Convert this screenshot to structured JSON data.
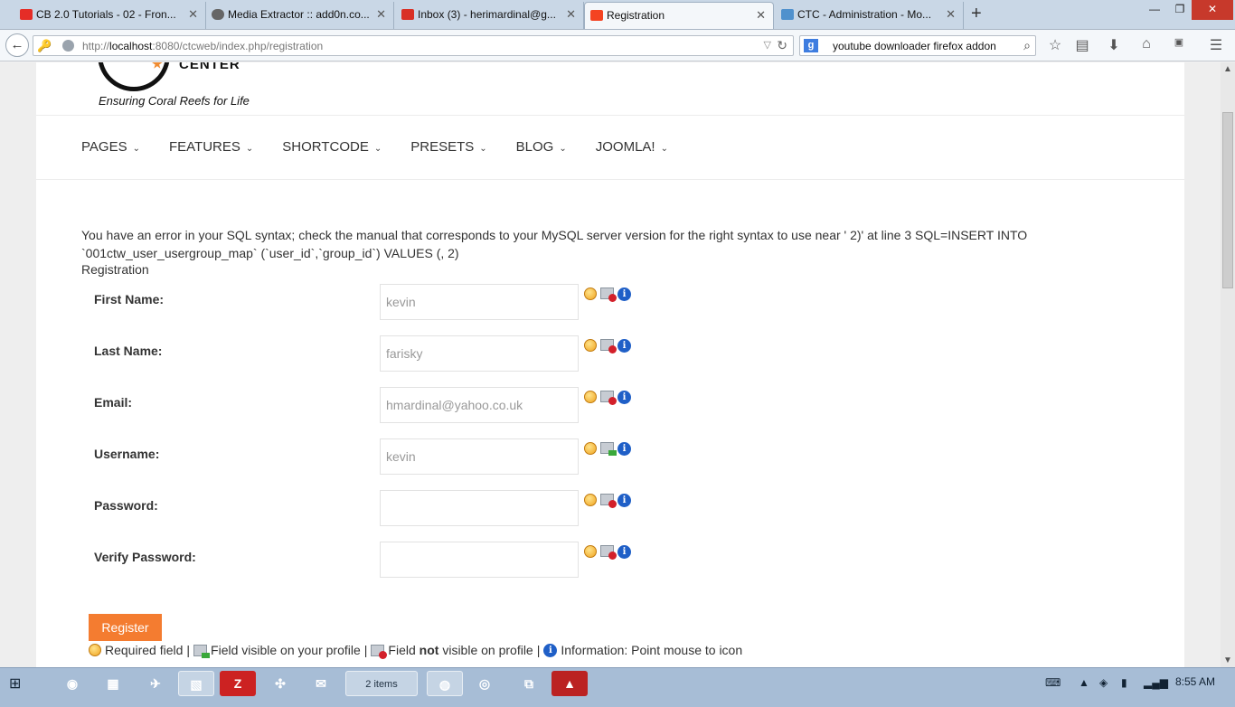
{
  "browser": {
    "tabs": [
      {
        "title": "CB 2.0 Tutorials - 02 - Fron...",
        "favicon": "youtube-icon",
        "color": "#e52d27"
      },
      {
        "title": "Media Extractor :: add0n.co...",
        "favicon": "cloud-icon",
        "color": "#555555"
      },
      {
        "title": "Inbox (3) - herimardinal@g...",
        "favicon": "gmail-icon",
        "color": "#d93025"
      },
      {
        "title": "Registration",
        "favicon": "joomla-icon",
        "color": "#f44321"
      },
      {
        "title": "CTC - Administration - Mo...",
        "favicon": "joomla-icon",
        "color": "#5091cd"
      }
    ],
    "url_host": "localhost",
    "url_pre": "http://",
    "url_post": ":8080/ctcweb/index.php/registration",
    "search_text": "youtube downloader firefox addon"
  },
  "site": {
    "logo_text": "CENTER",
    "tagline": "Ensuring Coral Reefs for Life",
    "menu": [
      "PAGES",
      "FEATURES",
      "SHORTCODE",
      "PRESETS",
      "BLOG",
      "JOOMLA!"
    ]
  },
  "content": {
    "error_line1": "You have an error in your SQL syntax; check the manual that corresponds to your MySQL server version for the right syntax to use near ' 2)' at line 3 SQL=INSERT INTO",
    "error_line2": "`001ctw_user_usergroup_map` (`user_id`,`group_id`) VALUES (, 2)",
    "title": "Registration"
  },
  "form": {
    "fields": [
      {
        "label": "First Name:",
        "value": "kevin",
        "visible": "no"
      },
      {
        "label": "Last Name:",
        "value": "farisky",
        "visible": "no"
      },
      {
        "label": "Email:",
        "value": "hmardinal@yahoo.co.uk",
        "visible": "no"
      },
      {
        "label": "Username:",
        "value": "kevin",
        "visible": "yes"
      },
      {
        "label": "Password:",
        "value": "",
        "visible": "no"
      },
      {
        "label": "Verify Password:",
        "value": "",
        "visible": "no"
      }
    ],
    "register_label": "Register",
    "legend": {
      "required": "Required field",
      "visible": "Field visible on your profile",
      "not_prefix": "Field",
      "not_bold": "not",
      "not_suffix": "visible on profile",
      "info": "Information: Point mouse to icon"
    }
  },
  "taskbar": {
    "clock": "8:55 AM",
    "badge_text": "2 items"
  }
}
